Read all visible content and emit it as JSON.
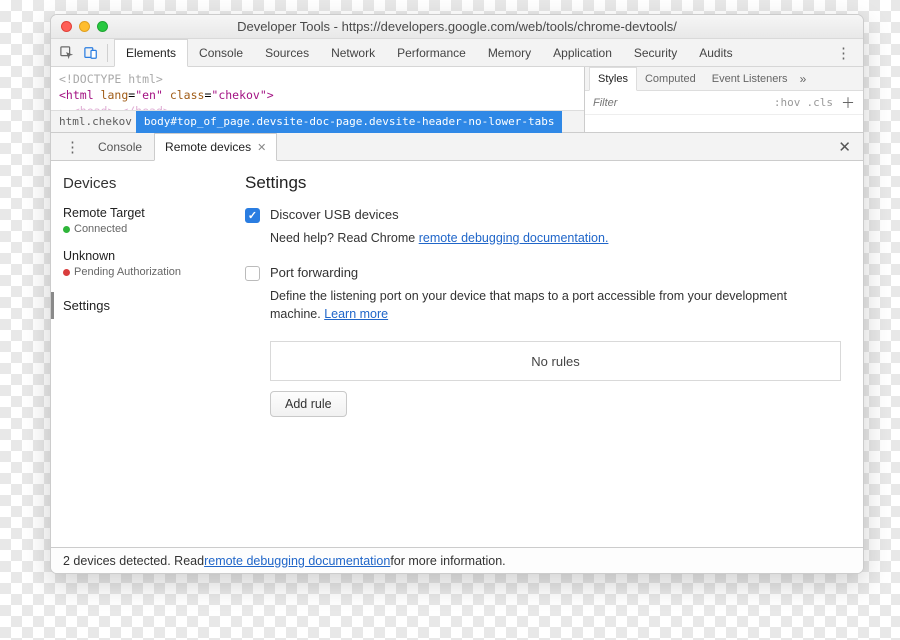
{
  "window": {
    "title": "Developer Tools - https://developers.google.com/web/tools/chrome-devtools/"
  },
  "main_tabs": [
    "Elements",
    "Console",
    "Sources",
    "Network",
    "Performance",
    "Memory",
    "Application",
    "Security",
    "Audits"
  ],
  "main_tab_active": 0,
  "source": {
    "line1": "<!DOCTYPE html>",
    "line2_open": "<html ",
    "line2_lang_k": "lang",
    "line2_lang_v": "\"en\"",
    "line2_class_k": "class",
    "line2_class_v": "\"chekov\"",
    "line2_close": ">",
    "line3": "<head> </head>",
    "crumb1": "html.chekov",
    "crumb_sel": "body#top_of_page.devsite-doc-page.devsite-header-no-lower-tabs"
  },
  "styles": {
    "tabs": [
      "Styles",
      "Computed",
      "Event Listeners"
    ],
    "filter_placeholder": "Filter",
    "hov": ":hov",
    "cls": ".cls"
  },
  "drawer": {
    "tabs": [
      {
        "label": "Console",
        "closable": false
      },
      {
        "label": "Remote devices",
        "closable": true
      }
    ],
    "active": 1
  },
  "devices_pane": {
    "heading": "Devices",
    "remote_target": {
      "title": "Remote Target",
      "status": "Connected"
    },
    "unknown": {
      "title": "Unknown",
      "status": "Pending Authorization"
    },
    "settings_label": "Settings"
  },
  "settings_pane": {
    "heading": "Settings",
    "discover_label": "Discover USB devices",
    "discover_checked": true,
    "discover_help_pre": "Need help? Read Chrome ",
    "discover_help_link": "remote debugging documentation.",
    "portfwd_label": "Port forwarding",
    "portfwd_checked": false,
    "portfwd_desc_pre": "Define the listening port on your device that maps to a port accessible from your development machine. ",
    "portfwd_desc_link": "Learn more",
    "no_rules": "No rules",
    "add_rule": "Add rule"
  },
  "statusbar": {
    "pre": "2 devices detected. Read ",
    "link": "remote debugging documentation",
    "post": " for more information."
  }
}
